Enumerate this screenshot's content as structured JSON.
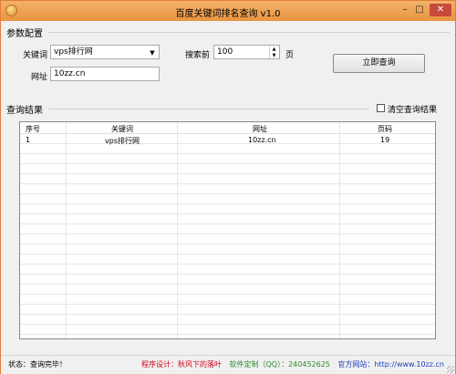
{
  "window": {
    "title": "百度关键词排名查询 v1.0",
    "min": "–",
    "max": "□",
    "close": "✕"
  },
  "params": {
    "group_title": "参数配置",
    "keyword_label": "关键词",
    "keyword_value": "vps排行网",
    "url_label": "网址",
    "url_value": "10zz.cn",
    "search_label": "搜索前",
    "search_value": "100",
    "page_unit": "页",
    "query_button": "立即查询"
  },
  "results": {
    "group_title": "查询结果",
    "clear_label": "清空查询结果",
    "columns": [
      "序号",
      "关键词",
      "网址",
      "页码"
    ],
    "rows": [
      [
        "1",
        "vps排行网",
        "10zz.cn",
        "19"
      ]
    ]
  },
  "status": {
    "left": "状态：查询完毕！",
    "design": "程序设计：秋风下的落叶",
    "custom": "软件定制（QQ）：240452625",
    "site": "官方网站：http://www.10zz.cn"
  },
  "colors": {
    "title_bar": "#e9933f",
    "design_text": "#d0021b",
    "custom_text": "#2e8b2e",
    "site_text": "#1f3fbf"
  }
}
